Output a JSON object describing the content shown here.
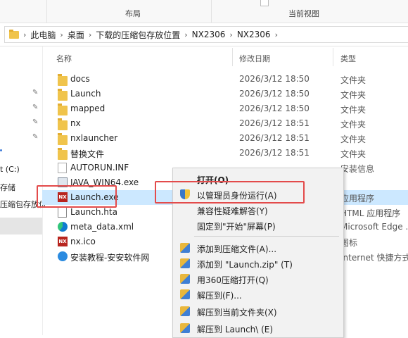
{
  "ribbon": {
    "group_layout": "布局",
    "group_view": "当前视图"
  },
  "address": {
    "crumbs": [
      "此电脑",
      "桌面",
      "下载的压缩包存放位置",
      "NX2306",
      "NX2306"
    ]
  },
  "sidebar": {
    "items": [
      "t (C:)",
      "存储",
      "压缩包存放位"
    ]
  },
  "columns": {
    "name": "名称",
    "date": "修改日期",
    "type": "类型"
  },
  "files": [
    {
      "icon": "folder-icon",
      "name": "docs",
      "date": "2026/3/12 18:50",
      "type": "文件夹"
    },
    {
      "icon": "folder-icon",
      "name": "Launch",
      "date": "2026/3/12 18:50",
      "type": "文件夹"
    },
    {
      "icon": "folder-icon",
      "name": "mapped",
      "date": "2026/3/12 18:50",
      "type": "文件夹"
    },
    {
      "icon": "folder-icon",
      "name": "nx",
      "date": "2026/3/12 18:51",
      "type": "文件夹"
    },
    {
      "icon": "folder-icon",
      "name": "nxlauncher",
      "date": "2026/3/12 18:51",
      "type": "文件夹"
    },
    {
      "icon": "folder-icon",
      "name": "替换文件",
      "date": "2026/3/12 18:51",
      "type": "文件夹"
    },
    {
      "icon": "file-icon",
      "name": "AUTORUN.INF",
      "date": "",
      "type": "安装信息"
    },
    {
      "icon": "exe-icon",
      "name": "JAVA_WIN64.exe",
      "date": "",
      "type": ""
    },
    {
      "icon": "nx-icon",
      "name": "Launch.exe",
      "date": "",
      "type": "应用程序"
    },
    {
      "icon": "hta-icon",
      "name": "Launch.hta",
      "date": "",
      "type": "HTML 应用程序"
    },
    {
      "icon": "edge-icon",
      "name": "meta_data.xml",
      "date": "",
      "type": "Microsoft Edge ..."
    },
    {
      "icon": "nx-icon",
      "name": "nx.ico",
      "date": "",
      "type": "图标"
    },
    {
      "icon": "web-shortcut-icon",
      "name": "安装教程-安安软件网",
      "date": "",
      "type": "Internet 快捷方式"
    }
  ],
  "context_menu": {
    "open": "打开(O)",
    "run_as_admin": "以管理员身份运行(A)",
    "compat": "兼容性疑难解答(Y)",
    "pin_start": "固定到\"开始\"屏幕(P)",
    "add_archive": "添加到压缩文件(A)...",
    "add_zip": "添加到 \"Launch.zip\" (T)",
    "open_360": "用360压缩打开(Q)",
    "extract_to": "解压到(F)...",
    "extract_here": "解压到当前文件夹(X)",
    "extract_folder": "解压到 Launch\\ (E)"
  },
  "colors": {
    "selection": "#cce8ff",
    "highlight_box": "#e34b4b",
    "folder": "#f0c44c"
  }
}
